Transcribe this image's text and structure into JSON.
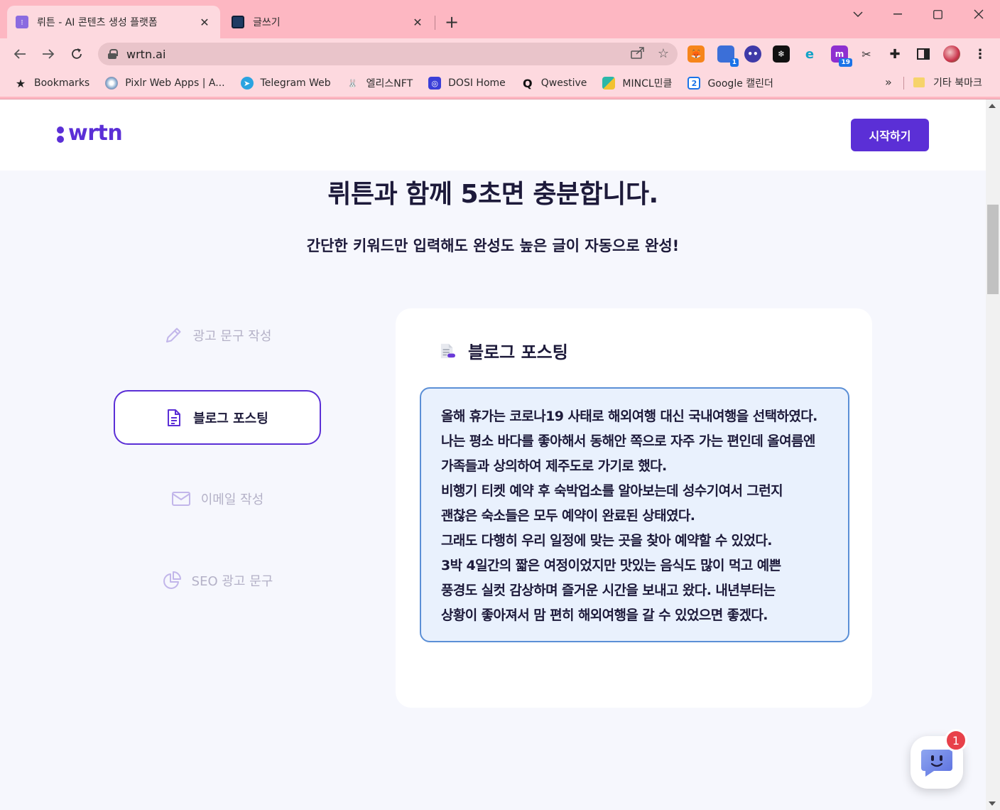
{
  "browser": {
    "tabs": [
      {
        "title": "뤼튼 - AI 콘텐츠 생성 플랫폼",
        "active": true
      },
      {
        "title": "글쓰기",
        "active": false
      }
    ],
    "url": "wrtn.ai",
    "bookmarks": [
      {
        "label": "Bookmarks",
        "icon": "star-icon"
      },
      {
        "label": "Pixlr Web Apps | A...",
        "icon": "pixlr-icon"
      },
      {
        "label": "Telegram Web",
        "icon": "telegram-icon"
      },
      {
        "label": "엘리스NFT",
        "icon": "rabbit-icon"
      },
      {
        "label": "DOSI Home",
        "icon": "dosi-icon"
      },
      {
        "label": "Qwestive",
        "icon": "qwestive-icon"
      },
      {
        "label": "MINCL민클",
        "icon": "mincl-icon"
      },
      {
        "label": "Google 캘린더",
        "icon": "calendar-icon"
      }
    ],
    "bookmarks_overflow": "»",
    "other_bookmarks": "기타 북마크",
    "extension_badges": {
      "ext1": "1",
      "ext2": "19"
    }
  },
  "header": {
    "logo_text": "wrtn",
    "start_button": "시작하기"
  },
  "hero": {
    "headline": "뤼튼과 함께 5초면 충분합니다.",
    "subline": "간단한 키워드만 입력해도 완성도 높은 글이 자동으로 완성!"
  },
  "menu": {
    "ad_copy": "광고 문구 작성",
    "blog": "블로그 포스팅",
    "email": "이메일 작성",
    "seo": "SEO 광고 문구"
  },
  "card": {
    "title": "블로그 포스팅",
    "lines": [
      "올해 휴가는 코로나19 사태로 해외여행 대신 국내여행을 선택하였다.",
      "나는 평소 바다를 좋아해서 동해안 쪽으로 자주 가는 편인데 올여름엔",
      "가족들과 상의하여 제주도로 가기로 했다.",
      "비행기 티켓 예약 후 숙박업소를 알아보는데 성수기여서 그런지",
      "괜찮은 숙소들은 모두 예약이 완료된 상태였다.",
      "그래도 다행히 우리 일정에 맞는 곳을 찾아 예약할 수 있었다.",
      "3박 4일간의 짧은 여정이었지만 맛있는 음식도 많이 먹고 예쁜",
      "풍경도 실컷 감상하며 즐거운 시간을 보내고 왔다. 내년부터는",
      "상황이 좋아져서 맘 편히 해외여행을 갈 수 있었으면 좋겠다."
    ]
  },
  "chat": {
    "badge": "1"
  },
  "colors": {
    "brand": "#5b2fd6",
    "chrome": "#fdb7c2",
    "textbox_border": "#5b8fd6"
  }
}
